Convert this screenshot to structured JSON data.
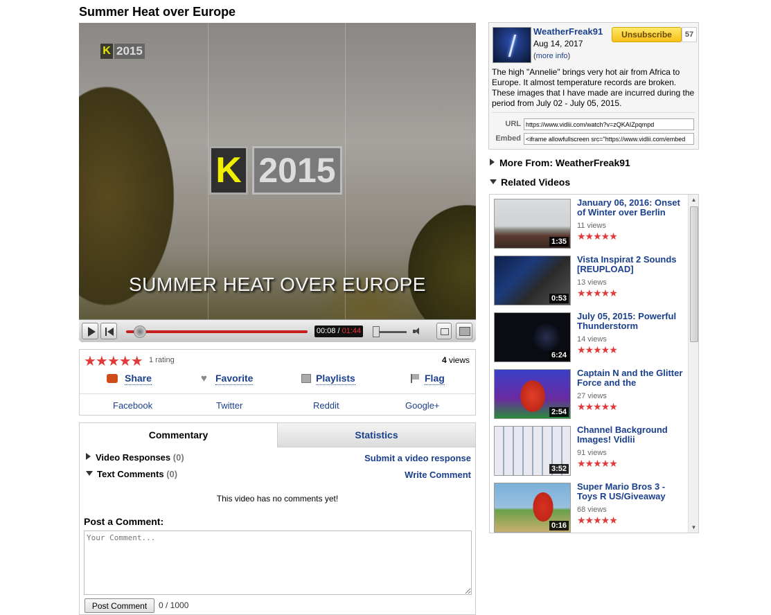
{
  "video": {
    "title": "Summer Heat over Europe",
    "logo_year": "2015",
    "logo_letter": "K",
    "caption": "SUMMER HEAT OVER EUROPE",
    "time_current": "00:08",
    "time_separator": " / ",
    "time_duration": "01:44",
    "progress_fraction": 0.077
  },
  "stats": {
    "rating_stars": "★★★★★",
    "rating_count": "1 rating",
    "views_number": "4",
    "views_label": " views"
  },
  "actions": {
    "share": "Share",
    "favorite": "Favorite",
    "playlists": "Playlists",
    "flag": "Flag"
  },
  "share_links": [
    "Facebook",
    "Twitter",
    "Reddit",
    "Google+"
  ],
  "tabs": {
    "commentary": "Commentary",
    "statistics": "Statistics"
  },
  "comments": {
    "video_responses_label": "Video Responses",
    "video_responses_count": "(0)",
    "text_comments_label": "Text Comments",
    "text_comments_count": "(0)",
    "submit_response": "Submit a video response",
    "write_comment": "Write Comment",
    "empty_message": "This video has no comments yet!",
    "post_label": "Post a Comment:",
    "placeholder": "Your Comment...",
    "post_button": "Post Comment",
    "char_count": "0 / 1000"
  },
  "channel": {
    "name": "WeatherFreak91",
    "date": "Aug 14, 2017",
    "more_info_open": "(",
    "more_info": "more info",
    "more_info_close": ")",
    "unsubscribe": "Unsubscribe",
    "subscriber_count": "57",
    "description": "The high \"Annelie\" brings very hot air from Africa to Europe. It almost temperature records are broken. These images that I have made are incurred during the period from July 02 - July 05, 2015.",
    "url_label": "URL",
    "url_value": "https://www.vidlii.com/watch?v=zQKAIZpqmpd",
    "embed_label": "Embed",
    "embed_value": "<iframe allowfullscreen src=\"https://www.vidlii.com/embed"
  },
  "sections": {
    "more_from": "More From: WeatherFreak91",
    "related": "Related Videos"
  },
  "related_videos": [
    {
      "title": "January 06, 2016: Onset of Winter over Berlin",
      "views": "11 views",
      "duration": "1:35",
      "stars": "★★★★★"
    },
    {
      "title": "Vista Inspirat 2 Sounds [REUPLOAD]",
      "views": "13 views",
      "duration": "0:53",
      "stars": "★★★★★"
    },
    {
      "title": "July 05, 2015: Powerful Thunderstorm",
      "views": "14 views",
      "duration": "6:24",
      "stars": "★★★★★"
    },
    {
      "title": "Captain N and the Glitter Force and the",
      "views": "27 views",
      "duration": "2:54",
      "stars": "★★★★★"
    },
    {
      "title": "Channel Background Images! Vidlii",
      "views": "91 views",
      "duration": "3:52",
      "stars": "★★★★★"
    },
    {
      "title": "Super Mario Bros 3 - Toys R US/Giveaway",
      "views": "68 views",
      "duration": "0:16",
      "stars": "★★★★★"
    }
  ],
  "colors": {
    "link": "#1a3f8c",
    "star": "#e03a3a",
    "progress": "#c41e1e",
    "subscribe_button": "#f7c01a"
  }
}
